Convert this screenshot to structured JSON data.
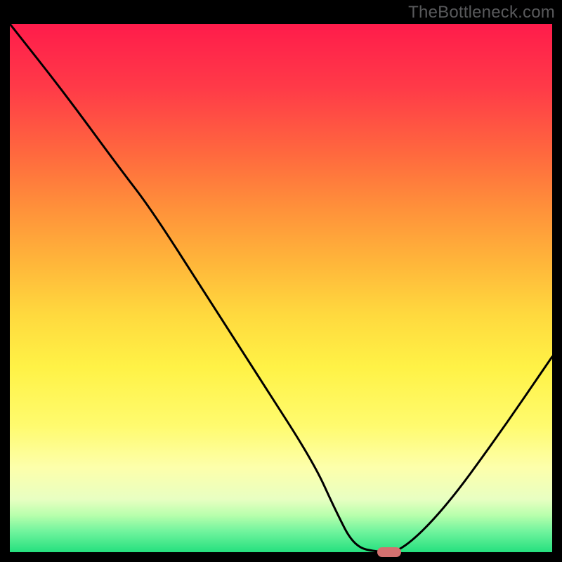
{
  "watermark": "TheBottleneck.com",
  "chart_data": {
    "type": "line",
    "title": "",
    "xlabel": "",
    "ylabel": "",
    "xlim": [
      0,
      100
    ],
    "ylim": [
      0,
      100
    ],
    "series": [
      {
        "name": "bottleneck-curve",
        "x": [
          0,
          10,
          20,
          26,
          36,
          46,
          56,
          60,
          63.5,
          68,
          72,
          80,
          90,
          100
        ],
        "values": [
          100,
          87,
          73,
          65,
          49,
          33,
          17,
          8,
          1,
          0,
          0,
          8,
          22,
          37
        ]
      }
    ],
    "marker": {
      "x": 70,
      "y": 0,
      "color": "#d4706f"
    },
    "gradient_stops": [
      {
        "pos": 0,
        "color": "#ff1c4b"
      },
      {
        "pos": 12,
        "color": "#ff3a48"
      },
      {
        "pos": 25,
        "color": "#ff6a3e"
      },
      {
        "pos": 35,
        "color": "#ff913a"
      },
      {
        "pos": 45,
        "color": "#ffb53a"
      },
      {
        "pos": 55,
        "color": "#ffd93e"
      },
      {
        "pos": 65,
        "color": "#fff246"
      },
      {
        "pos": 76,
        "color": "#fffb6e"
      },
      {
        "pos": 84,
        "color": "#fdffab"
      },
      {
        "pos": 90,
        "color": "#e8ffc2"
      },
      {
        "pos": 93,
        "color": "#b8ffac"
      },
      {
        "pos": 96,
        "color": "#72f49e"
      },
      {
        "pos": 100,
        "color": "#25e07e"
      }
    ]
  },
  "colors": {
    "frame": "#000000",
    "curve": "#000000",
    "watermark": "#58595b"
  }
}
